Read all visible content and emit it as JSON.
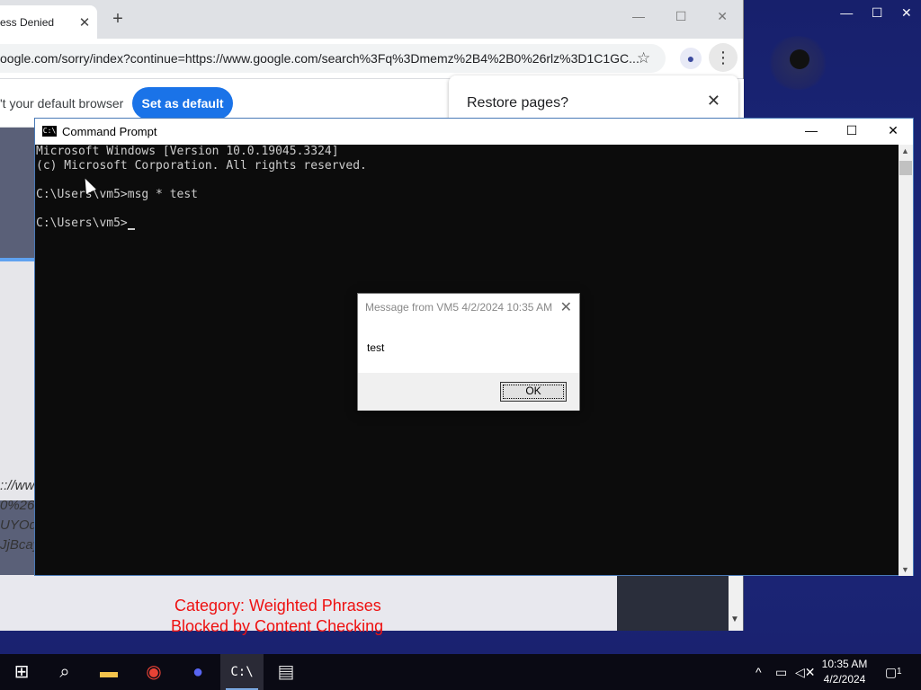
{
  "chrome": {
    "tab_title": "ess Denied",
    "tab_close": "✕",
    "new_tab": "+",
    "url": "oogle.com/sorry/index?continue=https://www.google.com/search%3Fq%3Dmemz%2B4%2B0%26rlz%3D1C1GC...",
    "infobar_text": "'t your default browser",
    "set_default_label": "Set as default",
    "restore_title": "Restore pages?",
    "restore_close": "✕",
    "page_lines": [
      ":://ww",
      "0%26r",
      "UYOd",
      "JjBcay"
    ],
    "category_text": "Category: Weighted Phrases",
    "blocked_text": "Blocked by Content Checking"
  },
  "cmd": {
    "title": "Command Prompt",
    "lines": [
      "Microsoft Windows [Version 10.0.19045.3324]",
      "(c) Microsoft Corporation. All rights reserved.",
      "",
      "C:\\Users\\vm5>msg * test",
      "",
      "C:\\Users\\vm5>"
    ]
  },
  "message_box": {
    "title": "Message from VM5 4/2/2024 10:35 AM",
    "text": "test",
    "ok_label": "OK"
  },
  "taskbar": {
    "time": "10:35 AM",
    "date": "4/2/2024",
    "notification_count": "1"
  },
  "icons": {
    "start": "windows-start-icon",
    "search": "search-icon",
    "explorer": "file-explorer-icon",
    "chrome": "chrome-icon",
    "discord": "discord-icon",
    "cmd": "command-prompt-icon",
    "app": "app-icon"
  },
  "colors": {
    "accent": "#1a73e8",
    "desktop": "#17206c",
    "cmd_bg": "#0c0c0c",
    "blocked_red": "#e11111"
  }
}
